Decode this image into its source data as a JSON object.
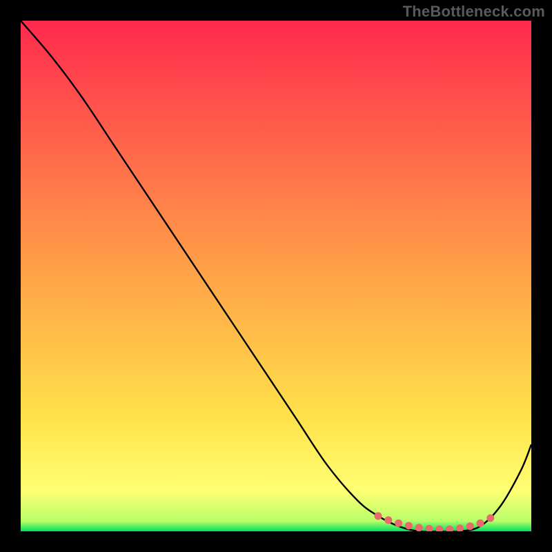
{
  "watermark": "TheBottleneck.com",
  "chart_data": {
    "type": "line",
    "title": "",
    "xlabel": "",
    "ylabel": "",
    "xlim": [
      0,
      100
    ],
    "ylim": [
      0,
      100
    ],
    "grid": false,
    "legend": false,
    "background_gradient": {
      "stops": [
        {
          "offset": 0.0,
          "color": "#ff2a4d"
        },
        {
          "offset": 0.5,
          "color": "#ffa448"
        },
        {
          "offset": 0.78,
          "color": "#ffe24a"
        },
        {
          "offset": 0.92,
          "color": "#ffff73"
        },
        {
          "offset": 0.98,
          "color": "#b8ff6a"
        },
        {
          "offset": 1.0,
          "color": "#00e05a"
        }
      ]
    },
    "series": [
      {
        "name": "bottleneck-curve",
        "color": "#000000",
        "x": [
          0,
          6,
          12,
          18,
          24,
          30,
          36,
          42,
          48,
          54,
          60,
          66,
          70,
          74,
          78,
          82,
          86,
          90,
          94,
          98,
          100
        ],
        "values": [
          100,
          93,
          85,
          76,
          67,
          58,
          49,
          40,
          31,
          22,
          13,
          6,
          3,
          1,
          0,
          0,
          0,
          1,
          5,
          12,
          17
        ]
      },
      {
        "name": "optimal-range",
        "color": "#e86a6a",
        "style": "dots",
        "x": [
          70,
          72,
          74,
          76,
          78,
          80,
          82,
          84,
          86,
          88,
          90,
          92
        ],
        "values": [
          3,
          2.2,
          1.6,
          1.1,
          0.7,
          0.5,
          0.4,
          0.4,
          0.6,
          1.0,
          1.6,
          2.6
        ]
      }
    ]
  }
}
